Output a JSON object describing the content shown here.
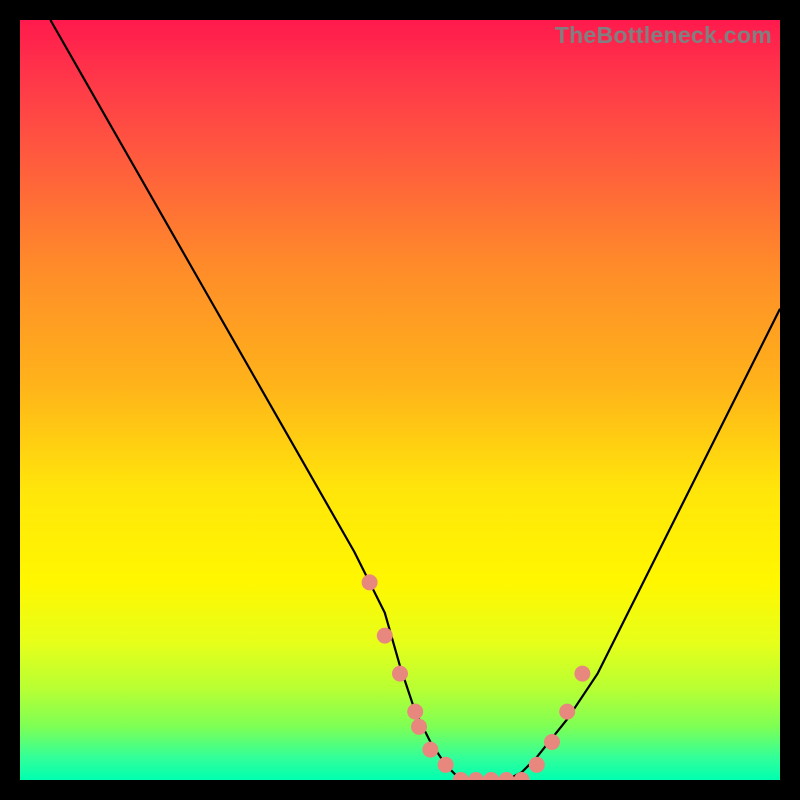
{
  "watermark": "TheBottleneck.com",
  "chart_data": {
    "type": "line",
    "title": "",
    "xlabel": "",
    "ylabel": "",
    "xlim": [
      0,
      100
    ],
    "ylim": [
      0,
      100
    ],
    "curve": {
      "name": "bottleneck-curve",
      "x": [
        4,
        8,
        12,
        16,
        20,
        24,
        28,
        32,
        36,
        40,
        44,
        48,
        50,
        52,
        54,
        56,
        58,
        60,
        62,
        64,
        66,
        68,
        72,
        76,
        80,
        84,
        88,
        92,
        96,
        100
      ],
      "y": [
        100,
        93,
        86,
        79,
        72,
        65,
        58,
        51,
        44,
        37,
        30,
        22,
        15,
        9,
        5,
        2,
        0,
        0,
        0,
        0,
        1,
        3,
        8,
        14,
        22,
        30,
        38,
        46,
        54,
        62
      ]
    },
    "marked_points": {
      "name": "highlight-dots",
      "x": [
        46,
        48,
        50,
        52,
        52.5,
        54,
        56,
        58,
        60,
        62,
        64,
        66,
        68,
        70,
        72,
        74
      ],
      "y": [
        26,
        19,
        14,
        9,
        7,
        4,
        2,
        0,
        0,
        0,
        0,
        0,
        2,
        5,
        9,
        14
      ]
    },
    "background_gradient": {
      "top": "#ff1a4d",
      "mid": "#ffe60a",
      "bottom": "#00ffb0"
    }
  }
}
